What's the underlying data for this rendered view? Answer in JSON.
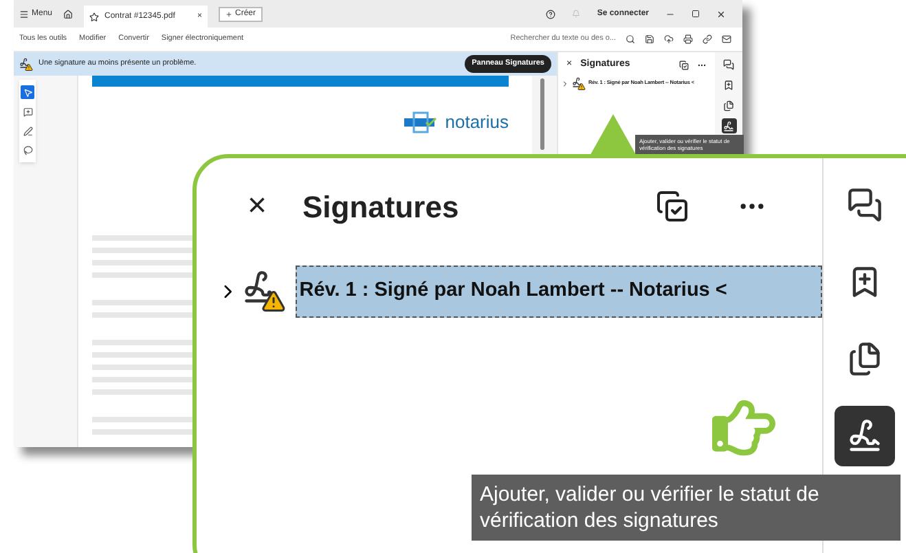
{
  "window": {
    "menu": "Menu",
    "tab": "Contrat #12345.pdf",
    "tab_close": "×",
    "new_tab": "Créer",
    "sign_in": "Se connecter"
  },
  "toolbar": {
    "items": [
      "Tous les outils",
      "Modifier",
      "Convertir",
      "Signer électroniquement"
    ],
    "search_placeholder": "Rechercher du texte ou des o..."
  },
  "banner": {
    "message": "Une signature au moins présente un problème.",
    "button": "Panneau Signatures"
  },
  "tools": [
    {
      "selected": true
    },
    {
      "selected": false
    },
    {
      "selected": false
    },
    {
      "selected": false
    }
  ],
  "document": {
    "logo": "notarius"
  },
  "side_panel": {
    "close": "×",
    "title": "Signatures",
    "signature": "Rév. 1 : Signé par Noah Lambert -- Notarius <",
    "tooltip": "Ajouter, valider ou vérifier le statut de vérification des signatures",
    "rail": [
      {
        "selected": false
      },
      {
        "selected": false
      },
      {
        "selected": false
      },
      {
        "selected": true
      }
    ]
  },
  "callout": {
    "close": "×",
    "title": "Signatures",
    "signature": "Rév. 1 : Signé par Noah Lambert -- Notarius <",
    "tooltip": "Ajouter, valider ou vérifier le statut de vérification des signatures",
    "rail": [
      {
        "selected": false
      },
      {
        "selected": false
      },
      {
        "selected": false
      },
      {
        "selected": true
      }
    ]
  }
}
